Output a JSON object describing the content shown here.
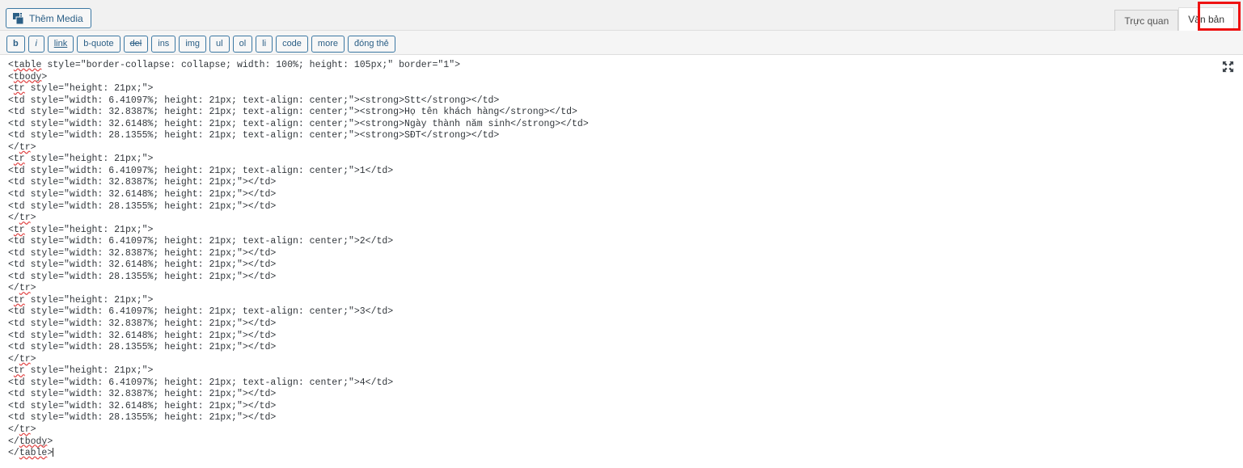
{
  "header": {
    "media_button_label": "Thêm Media",
    "media_icon": "add-media-icon",
    "tabs": [
      {
        "label": "Trực quan",
        "active": false
      },
      {
        "label": "Văn bản",
        "active": true
      }
    ],
    "annotation_color": "#ee1111"
  },
  "quicktags": [
    {
      "label": "b",
      "name": "bold"
    },
    {
      "label": "i",
      "name": "italic"
    },
    {
      "label": "link",
      "name": "link"
    },
    {
      "label": "b-quote",
      "name": "blockquote"
    },
    {
      "label": "del",
      "name": "del"
    },
    {
      "label": "ins",
      "name": "ins"
    },
    {
      "label": "img",
      "name": "img"
    },
    {
      "label": "ul",
      "name": "ul"
    },
    {
      "label": "ol",
      "name": "ol"
    },
    {
      "label": "li",
      "name": "li"
    },
    {
      "label": "code",
      "name": "code"
    },
    {
      "label": "more",
      "name": "more"
    },
    {
      "label": "đóng thẻ",
      "name": "close-tags"
    }
  ],
  "editor": {
    "fullscreen_icon": "fullscreen-expand-icon",
    "caret_visible": true,
    "code_lines": [
      "<table style=\"border-collapse: collapse; width: 100%; height: 105px;\" border=\"1\">",
      "<tbody>",
      "<tr style=\"height: 21px;\">",
      "<td style=\"width: 6.41097%; height: 21px; text-align: center;\"><strong>Stt</strong></td>",
      "<td style=\"width: 32.8387%; height: 21px; text-align: center;\"><strong>Họ tên khách hàng</strong></td>",
      "<td style=\"width: 32.6148%; height: 21px; text-align: center;\"><strong>Ngày thành năm sinh</strong></td>",
      "<td style=\"width: 28.1355%; height: 21px; text-align: center;\"><strong>SĐT</strong></td>",
      "</tr>",
      "<tr style=\"height: 21px;\">",
      "<td style=\"width: 6.41097%; height: 21px; text-align: center;\">1</td>",
      "<td style=\"width: 32.8387%; height: 21px;\"></td>",
      "<td style=\"width: 32.6148%; height: 21px;\"></td>",
      "<td style=\"width: 28.1355%; height: 21px;\"></td>",
      "</tr>",
      "<tr style=\"height: 21px;\">",
      "<td style=\"width: 6.41097%; height: 21px; text-align: center;\">2</td>",
      "<td style=\"width: 32.8387%; height: 21px;\"></td>",
      "<td style=\"width: 32.6148%; height: 21px;\"></td>",
      "<td style=\"width: 28.1355%; height: 21px;\"></td>",
      "</tr>",
      "<tr style=\"height: 21px;\">",
      "<td style=\"width: 6.41097%; height: 21px; text-align: center;\">3</td>",
      "<td style=\"width: 32.8387%; height: 21px;\"></td>",
      "<td style=\"width: 32.6148%; height: 21px;\"></td>",
      "<td style=\"width: 28.1355%; height: 21px;\"></td>",
      "</tr>",
      "<tr style=\"height: 21px;\">",
      "<td style=\"width: 6.41097%; height: 21px; text-align: center;\">4</td>",
      "<td style=\"width: 32.8387%; height: 21px;\"></td>",
      "<td style=\"width: 32.6148%; height: 21px;\"></td>",
      "<td style=\"width: 28.1355%; height: 21px;\"></td>",
      "</tr>",
      "</tbody>",
      "</table>"
    ]
  }
}
